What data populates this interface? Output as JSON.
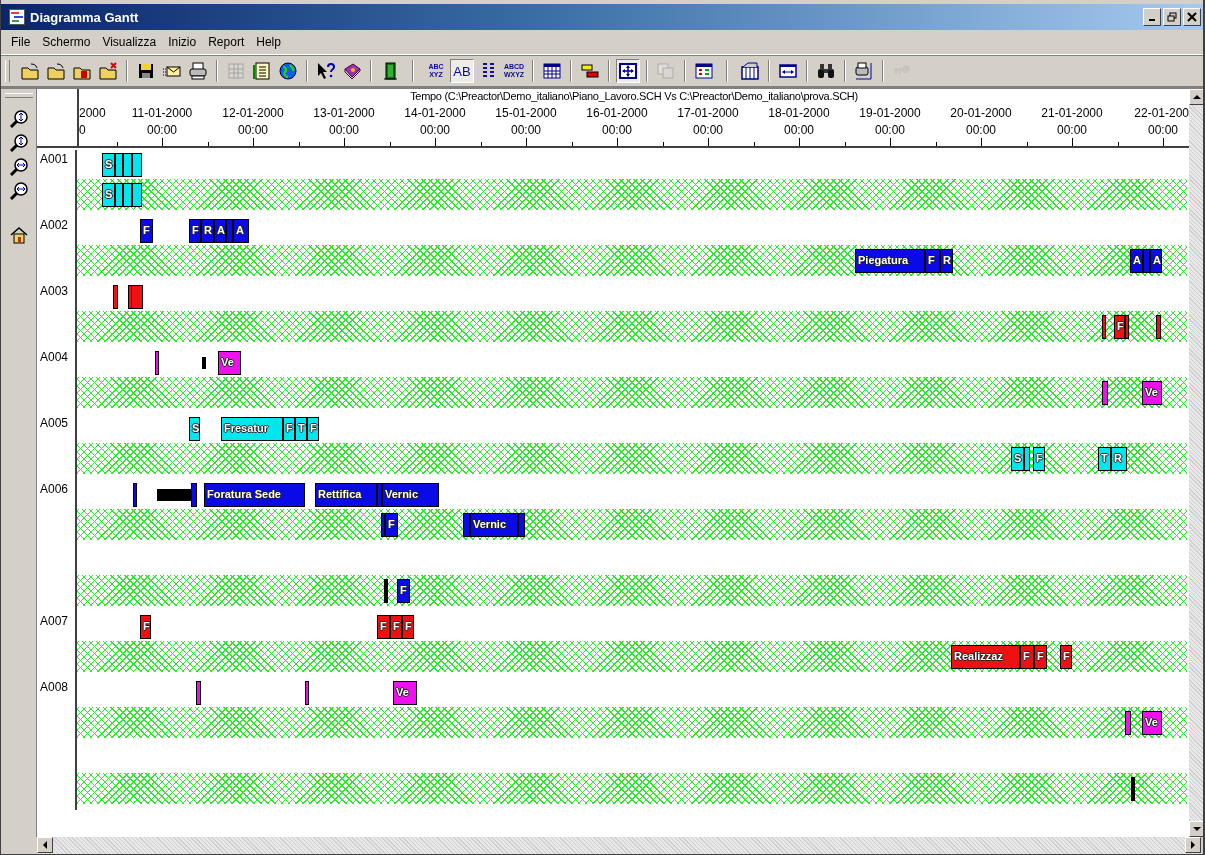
{
  "window": {
    "title": "Diagramma Gantt"
  },
  "menu": [
    "File",
    "Schermo",
    "Visualizza",
    "Inizio",
    "Report",
    "Help"
  ],
  "toolbar_groups": [
    [
      {
        "kind": "icon",
        "selected": false,
        "disabled": false
      },
      {
        "kind": "icon",
        "selected": false,
        "disabled": false
      },
      {
        "kind": "icon",
        "selected": false,
        "disabled": false
      },
      {
        "kind": "icon",
        "selected": false,
        "disabled": false
      }
    ],
    [
      {
        "kind": "icon",
        "selected": false,
        "disabled": false
      },
      {
        "kind": "icon",
        "selected": false,
        "disabled": false
      },
      {
        "kind": "icon",
        "selected": false,
        "disabled": false
      }
    ],
    [
      {
        "kind": "icon",
        "selected": false,
        "disabled": true
      },
      {
        "kind": "icon",
        "selected": false,
        "disabled": false
      },
      {
        "kind": "icon",
        "selected": false,
        "disabled": false
      }
    ],
    [
      {
        "kind": "icon",
        "selected": false,
        "disabled": false
      },
      {
        "kind": "icon",
        "selected": false,
        "disabled": false
      }
    ],
    [
      {
        "kind": "icon",
        "selected": false,
        "disabled": false
      }
    ],
    [
      {
        "kind": "text",
        "label": "ABC XYZ",
        "selected": false,
        "disabled": false
      },
      {
        "kind": "text",
        "label": "AB",
        "selected": true,
        "disabled": false
      },
      {
        "kind": "icon",
        "selected": false,
        "disabled": false
      },
      {
        "kind": "text",
        "label": "ABCD WXYZ",
        "selected": false,
        "disabled": false
      }
    ],
    [
      {
        "kind": "icon",
        "selected": false,
        "disabled": false
      }
    ],
    [
      {
        "kind": "icon",
        "selected": false,
        "disabled": false
      }
    ],
    [
      {
        "kind": "icon",
        "selected": true,
        "disabled": false
      }
    ],
    [
      {
        "kind": "icon",
        "selected": false,
        "disabled": true
      }
    ],
    [
      {
        "kind": "icon",
        "selected": false,
        "disabled": false
      }
    ],
    [
      {
        "kind": "icon",
        "selected": false,
        "disabled": false
      }
    ],
    [
      {
        "kind": "icon",
        "selected": false,
        "disabled": false
      }
    ],
    [
      {
        "kind": "icon",
        "selected": false,
        "disabled": false
      }
    ],
    [
      {
        "kind": "icon",
        "selected": false,
        "disabled": false
      }
    ],
    [
      {
        "kind": "icon",
        "selected": false,
        "disabled": true
      }
    ]
  ],
  "timeline": {
    "title": "Tempo (C:\\Preactor\\Demo_italiano\\Piano_Lavoro.SCH Vs C:\\Preactor\\Demo_italiano\\prova.SCH)",
    "ticks": [
      {
        "date": "2000",
        "time": "0"
      },
      {
        "date": "11-01-2000",
        "time": "00:00"
      },
      {
        "date": "12-01-2000",
        "time": "00:00"
      },
      {
        "date": "13-01-2000",
        "time": "00:00"
      },
      {
        "date": "14-01-2000",
        "time": "00:00"
      },
      {
        "date": "15-01-2000",
        "time": "00:00"
      },
      {
        "date": "16-01-2000",
        "time": "00:00"
      },
      {
        "date": "17-01-2000",
        "time": "00:00"
      },
      {
        "date": "18-01-2000",
        "time": "00:00"
      },
      {
        "date": "19-01-2000",
        "time": "00:00"
      },
      {
        "date": "20-01-2000",
        "time": "00:00"
      },
      {
        "date": "21-01-2000",
        "time": "00:00"
      },
      {
        "date": "22-01-200",
        "time": "00:00"
      }
    ]
  },
  "rows": [
    {
      "resource": "A001",
      "plan": [
        {
          "label": "S",
          "color": "#00e6ee"
        },
        {
          "color": "#00e6ee"
        },
        {
          "color": "#00e6ee"
        },
        {
          "color": "#00e6ee"
        }
      ],
      "actual": [
        {
          "label": "S",
          "color": "#00e6ee"
        },
        {
          "color": "#00e6ee"
        },
        {
          "color": "#00e6ee"
        },
        {
          "color": "#00e6ee"
        }
      ]
    },
    {
      "resource": "A002",
      "plan": [
        {
          "label": "F",
          "color": "#0a0ae6"
        },
        {
          "label": "F",
          "color": "#0a0ae6"
        },
        {
          "label": "R",
          "color": "#0a0ae6"
        },
        {
          "label": "A",
          "color": "#0a0ae6"
        },
        {
          "color": "#0a0ae6"
        },
        {
          "label": "A",
          "color": "#0a0ae6"
        }
      ],
      "actual": [
        {
          "label": "Piegatura",
          "color": "#0a0ae6"
        },
        {
          "label": "F",
          "color": "#0a0ae6"
        },
        {
          "label": "R",
          "color": "#0a0ae6"
        },
        {
          "label": "A",
          "color": "#0a0ae6"
        },
        {
          "color": "#0a0ae6"
        },
        {
          "label": "A",
          "color": "#0a0ae6"
        }
      ]
    },
    {
      "resource": "A003",
      "plan": [
        {
          "color": "#ee1111"
        },
        {
          "color": "#ee1111"
        },
        {
          "color": "#ee1111"
        }
      ],
      "actual": [
        {
          "color": "#ee1111"
        },
        {
          "label": "F",
          "color": "#ee1111"
        },
        {
          "color": "#ee1111"
        },
        {
          "color": "#ee1111"
        }
      ]
    },
    {
      "resource": "A004",
      "plan": [
        {
          "color": "#ee11ee"
        },
        {
          "color": "#000000"
        },
        {
          "label": "Ve",
          "color": "#ee11ee"
        }
      ],
      "actual": [
        {
          "color": "#ee11ee"
        },
        {
          "label": "Ve",
          "color": "#ee11ee"
        }
      ]
    },
    {
      "resource": "A005",
      "plan": [
        {
          "label": "S",
          "color": "#00e6ee"
        },
        {
          "label": "Fresatur",
          "color": "#00e6ee"
        },
        {
          "label": "F",
          "color": "#00e6ee"
        },
        {
          "label": "T",
          "color": "#00e6ee"
        },
        {
          "label": "F",
          "color": "#00e6ee"
        }
      ],
      "actual": [
        {
          "label": "S",
          "color": "#00e6ee"
        },
        {
          "color": "#00e6ee"
        },
        {
          "label": "F",
          "color": "#00e6ee"
        },
        {
          "label": "T",
          "color": "#00e6ee"
        },
        {
          "label": "R",
          "color": "#00e6ee"
        }
      ]
    },
    {
      "resource": "A006",
      "plan": [
        {
          "color": "#0a0ae6"
        },
        {
          "color": "#000000"
        },
        {
          "color": "#0a0ae6"
        },
        {
          "label": "Foratura Sede",
          "color": "#0a0ae6"
        },
        {
          "label": "Rettifica",
          "color": "#0a0ae6"
        },
        {
          "color": "#0a0ae6"
        },
        {
          "label": "Vernic",
          "color": "#0a0ae6"
        }
      ],
      "actual": [
        {
          "color": "#0a0ae6"
        },
        {
          "label": "F",
          "color": "#0a0ae6"
        },
        {
          "color": "#0a0ae6"
        },
        {
          "label": "Vernic",
          "color": "#0a0ae6"
        },
        {
          "color": "#0a0ae6"
        }
      ]
    },
    {
      "actual": [
        {
          "color": "#000000"
        },
        {
          "label": "F",
          "color": "#0a0ae6"
        }
      ]
    },
    {
      "resource": "A007",
      "plan": [
        {
          "label": "F",
          "color": "#ee1111"
        },
        {
          "label": "F",
          "color": "#ee1111"
        },
        {
          "label": "F",
          "color": "#ee1111"
        },
        {
          "label": "F",
          "color": "#ee1111"
        }
      ],
      "actual": [
        {
          "label": "Realizzaz",
          "color": "#ee1111"
        },
        {
          "label": "F",
          "color": "#ee1111"
        },
        {
          "label": "F",
          "color": "#ee1111"
        },
        {
          "label": "F",
          "color": "#ee1111"
        }
      ]
    },
    {
      "resource": "A008",
      "plan": [
        {
          "color": "#ee11ee"
        },
        {
          "color": "#ee11ee"
        },
        {
          "label": "Ve",
          "color": "#ee11ee"
        }
      ],
      "actual": [
        {
          "color": "#ee11ee"
        },
        {
          "label": "Ve",
          "color": "#ee11ee"
        }
      ]
    },
    {
      "actual": [
        {
          "color": "#000000"
        }
      ]
    }
  ]
}
